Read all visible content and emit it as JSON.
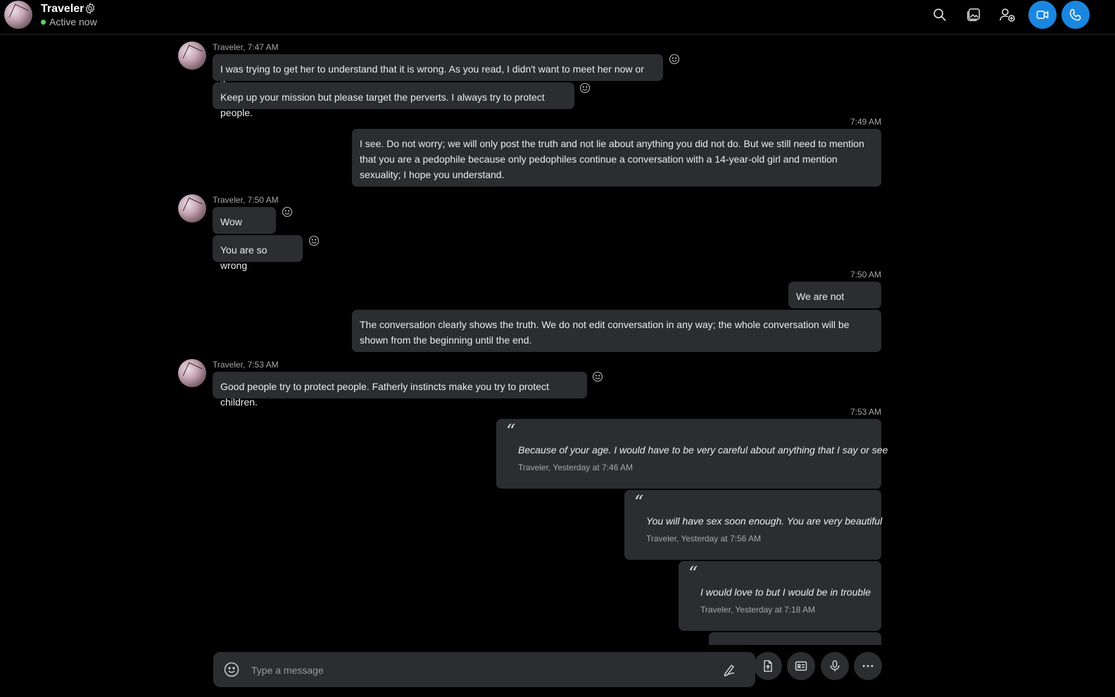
{
  "header": {
    "title": "Traveler",
    "status": "Active now",
    "status_color": "#5fd35f",
    "accent_color": "#1a86e0",
    "actions": [
      "search-icon",
      "gallery-icon",
      "add-person-icon",
      "video-call-icon",
      "audio-call-icon"
    ]
  },
  "messages": {
    "g1": {
      "meta": "Traveler, 7:47 AM",
      "m1": "I was trying to get her to understand that it is wrong.  As you read, I didn't want to meet her now or then",
      "m2": "Keep up your mission but please target the perverts. I always try to protect people."
    },
    "o1": {
      "time": "7:49 AM",
      "m1": "I see. Do not worry; we will only post the truth and not lie about anything you did not do. But we still need to mention that you are a pedophile because only pedophiles continue a conversation with a 14-year-old girl and mention sexuality; I hope you understand."
    },
    "g2": {
      "meta": "Traveler, 7:50 AM",
      "m1": "Wow",
      "m2": "You are so wrong"
    },
    "o2": {
      "time": "7:50 AM",
      "m1": "We are not wrong.",
      "m2": "The conversation clearly shows the truth. We do not edit conversation in any way; the whole conversation will be shown from the beginning until the end."
    },
    "g3": {
      "meta": "Traveler, 7:53 AM",
      "m1": "Good people try to protect people.  Fatherly instincts make you try to protect children."
    },
    "o3": {
      "time": "7:53 AM",
      "quotes": [
        {
          "text": "Because of your age. I would have to be very careful about anything that I say or see",
          "author": "Traveler, Yesterday at 7:46 AM"
        },
        {
          "text": "You will have sex soon enough. You are very beautiful",
          "author": "Traveler, Yesterday at 7:56 AM"
        },
        {
          "text": "I would love to but I would be in trouble",
          "author": "Traveler, Yesterday at 7:18 AM"
        }
      ]
    }
  },
  "composer": {
    "placeholder": "Type a message",
    "buttons": [
      "emoji-icon",
      "pen-icon",
      "file-icon",
      "contact-card-icon",
      "microphone-icon",
      "more-icon"
    ]
  }
}
